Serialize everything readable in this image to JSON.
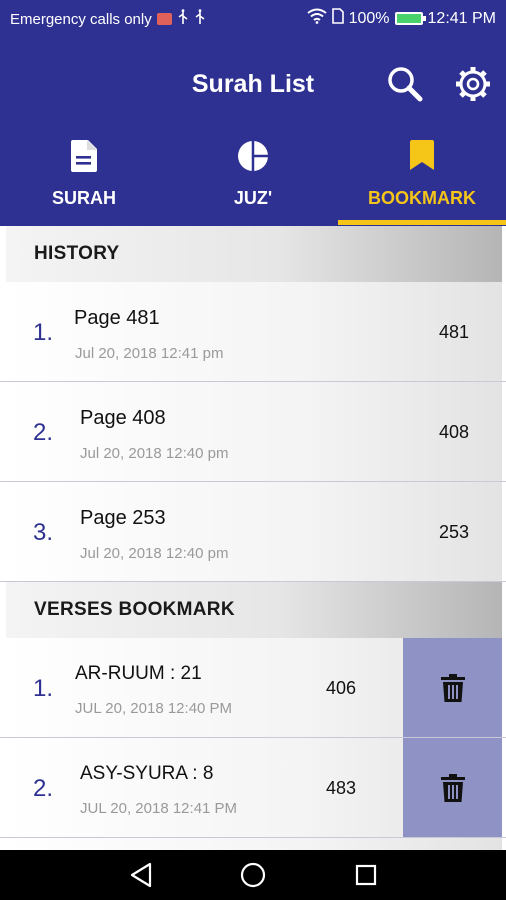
{
  "status_bar": {
    "carrier_text": "Emergency calls only",
    "battery_percent": "100%",
    "time": "12:41 PM",
    "icons": [
      "sms-icon",
      "usb-icon",
      "usb-icon",
      "wifi-icon",
      "sim-icon",
      "battery-icon"
    ]
  },
  "app_bar": {
    "title": "Surah List",
    "icons": [
      "search-icon",
      "settings-icon"
    ]
  },
  "tabs": [
    {
      "label": "SURAH",
      "icon": "document-icon",
      "selected": false
    },
    {
      "label": "JUZ'",
      "icon": "pie-chart-icon",
      "selected": false
    },
    {
      "label": "BOOKMARK",
      "icon": "bookmark-icon",
      "selected": true
    }
  ],
  "colors": {
    "primary": "#2e3191",
    "accent": "#f5c518",
    "delete_panel": "#8f92c4",
    "date_text": "#9a9a9a"
  },
  "history": {
    "header": "HISTORY",
    "items": [
      {
        "num": "1.",
        "title": "Page 481",
        "date": "Jul 20, 2018 12:41 pm",
        "page": "481"
      },
      {
        "num": "2.",
        "title": "Page 408",
        "date": "Jul 20, 2018 12:40 pm",
        "page": "408"
      },
      {
        "num": "3.",
        "title": "Page 253",
        "date": "Jul 20, 2018 12:40 pm",
        "page": "253"
      }
    ]
  },
  "verses_bookmark": {
    "header": "VERSES BOOKMARK",
    "items": [
      {
        "num": "1.",
        "title": "AR-RUUM : 21",
        "date": "JUL 20, 2018 12:40 PM",
        "page": "406",
        "action_icon": "trash-icon"
      },
      {
        "num": "2.",
        "title": "ASY-SYURA : 8",
        "date": "JUL 20, 2018 12:41 PM",
        "page": "483",
        "action_icon": "trash-icon"
      }
    ]
  },
  "nav_bar": {
    "icons": [
      "back-icon",
      "home-icon",
      "recents-icon"
    ]
  }
}
